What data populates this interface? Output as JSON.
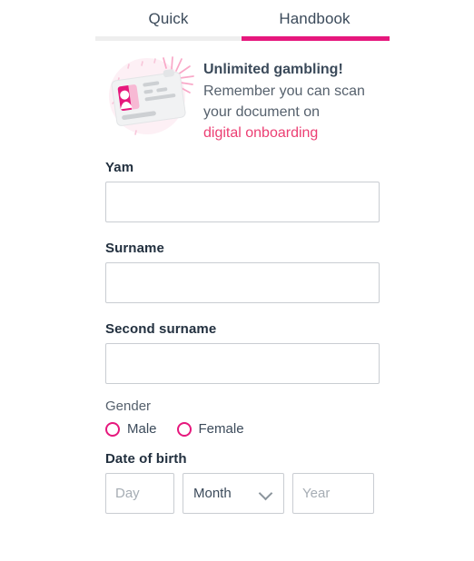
{
  "tabs": [
    {
      "label": "Quick",
      "active": false
    },
    {
      "label": "Handbook",
      "active": true
    }
  ],
  "colors": {
    "accent": "#e6187d",
    "link": "#ec3f73",
    "tab_track": "#eeeeee",
    "label": "#22303f",
    "muted_text": "#56616d",
    "input_border": "#c9cdd2",
    "placeholder": "#a6adb4"
  },
  "banner": {
    "icon": "id-card-scan-icon",
    "title": "Unlimited gambling!",
    "line1": "Remember you can scan",
    "line2": "your document on",
    "link": "digital onboarding"
  },
  "form": {
    "name": {
      "label": "Yam",
      "value": "",
      "placeholder": ""
    },
    "surname": {
      "label": "Surname",
      "value": "",
      "placeholder": ""
    },
    "second_surname": {
      "label": "Second surname",
      "value": "",
      "placeholder": ""
    },
    "gender": {
      "label": "Gender",
      "options": [
        {
          "label": "Male",
          "selected": false
        },
        {
          "label": "Female",
          "selected": false
        }
      ]
    },
    "date_of_birth": {
      "label": "Date of birth",
      "day": {
        "value": "",
        "placeholder": "Day"
      },
      "month": {
        "value": "Month",
        "icon": "chevron-down-icon"
      },
      "year": {
        "value": "",
        "placeholder": "Year"
      }
    }
  }
}
